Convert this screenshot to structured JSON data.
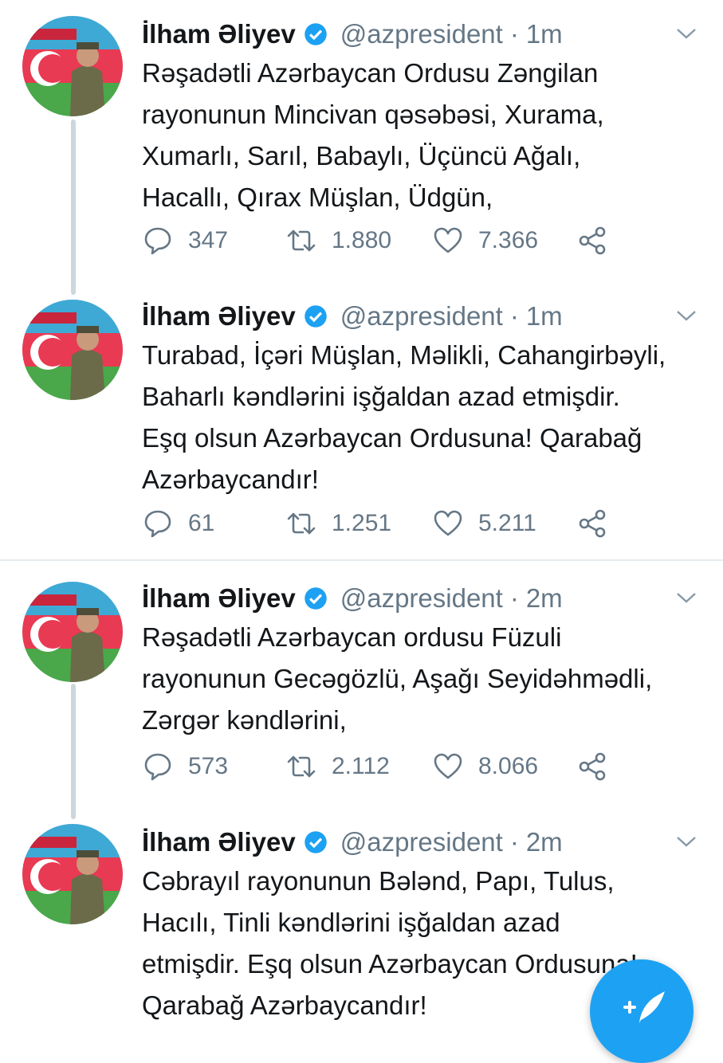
{
  "colors": {
    "accent": "#1da1f2",
    "secondary_text": "#657786",
    "divider": "#e6ecf0"
  },
  "tweets": [
    {
      "name": "İlham Əliyev",
      "handle": "@azpresident",
      "separator": "·",
      "time": "1m",
      "lines": [
        "Rəşadətli Azərbaycan Ordusu Zəngilan",
        "rayonunun Mincivan qəsəbəsi, Xurama,",
        "Xumarlı, Sarıl, Babaylı, Üçüncü Ağalı,",
        "Hacallı, Qırax Müşlan, Üdgün,"
      ],
      "replies": "347",
      "retweets": "1.880",
      "likes": "7.366"
    },
    {
      "name": "İlham Əliyev",
      "handle": "@azpresident",
      "separator": "·",
      "time": "1m",
      "lines": [
        "Turabad, İçəri Müşlan, Məlikli, Cahangirbəyli,",
        "Baharlı kəndlərini işğaldan azad etmişdir.",
        "Eşq olsun Azərbaycan Ordusuna! Qarabağ",
        "Azərbaycandır!"
      ],
      "replies": "61",
      "retweets": "1.251",
      "likes": "5.211"
    },
    {
      "name": "İlham Əliyev",
      "handle": "@azpresident",
      "separator": "·",
      "time": "2m",
      "lines": [
        "Rəşadətli Azərbaycan ordusu Füzuli",
        "rayonunun Gecəgözlü, Aşağı Seyidəhmədli,",
        "Zərgər kəndlərini,"
      ],
      "replies": "573",
      "retweets": "2.112",
      "likes": "8.066"
    },
    {
      "name": "İlham Əliyev",
      "handle": "@azpresident",
      "separator": "·",
      "time": "2m",
      "lines": [
        "Cəbrayıl rayonunun Bələnd, Papı, Tulus,",
        "Hacılı, Tinli kəndlərini işğaldan azad",
        "etmişdir. Eşq olsun Azərbaycan Ordusuna!",
        "Qarabağ Azərbaycandır!"
      ]
    }
  ],
  "icons": {
    "reply": "reply-icon",
    "retweet": "retweet-icon",
    "like": "heart-icon",
    "share": "share-icon",
    "verified": "verified-badge-icon",
    "menu": "chevron-down-icon",
    "compose": "compose-tweet-icon"
  }
}
